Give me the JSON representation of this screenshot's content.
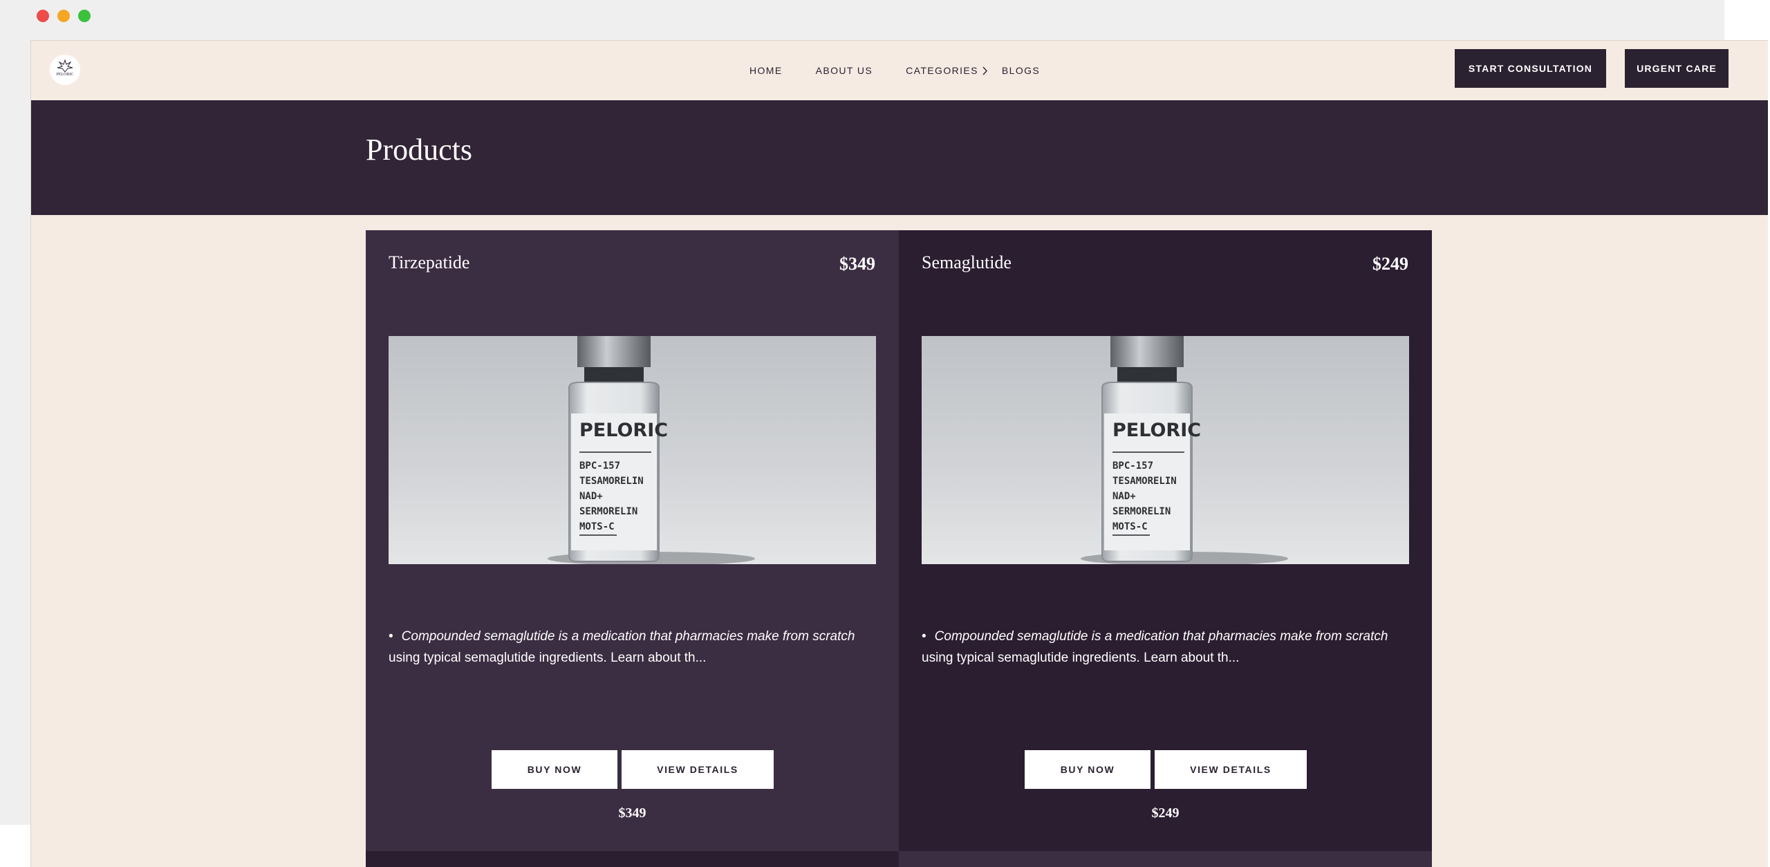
{
  "logo": {
    "text": "PELORIC"
  },
  "nav": {
    "items": [
      {
        "label": "HOME"
      },
      {
        "label": "ABOUT US"
      },
      {
        "label": "CATEGORIES"
      },
      {
        "label": "BLOGS"
      }
    ]
  },
  "header": {
    "consult_label": "START CONSULTATION",
    "urgent_label": "URGENT CARE"
  },
  "banner": {
    "title": "Products"
  },
  "vial_label": {
    "brand": "PELORIC",
    "lines": [
      "BPC-157",
      "TESAMORELIN",
      "NAD+",
      "SERMORELIN",
      "MOTS-C"
    ]
  },
  "products": [
    {
      "name": "Tirzepatide",
      "price": "$349",
      "desc_italic": "Compounded semaglutide is a medication that pharmacies make from scratch",
      "desc_rest": " using typical semaglutide ingredients. Learn about th...",
      "buy_label": "BUY NOW",
      "view_label": "VIEW DETAILS",
      "bottom_price": "$349"
    },
    {
      "name": "Semaglutide",
      "price": "$249",
      "desc_italic": "Compounded semaglutide is a medication that pharmacies make from scratch",
      "desc_rest": " using typical semaglutide ingredients. Learn about th...",
      "buy_label": "BUY NOW",
      "view_label": "VIEW DETAILS",
      "bottom_price": "$249"
    }
  ],
  "colors": {
    "cream": "#f6ebe3",
    "plum_dark": "#2b1e31",
    "plum_light": "#3b2d42",
    "banner": "#322537"
  }
}
